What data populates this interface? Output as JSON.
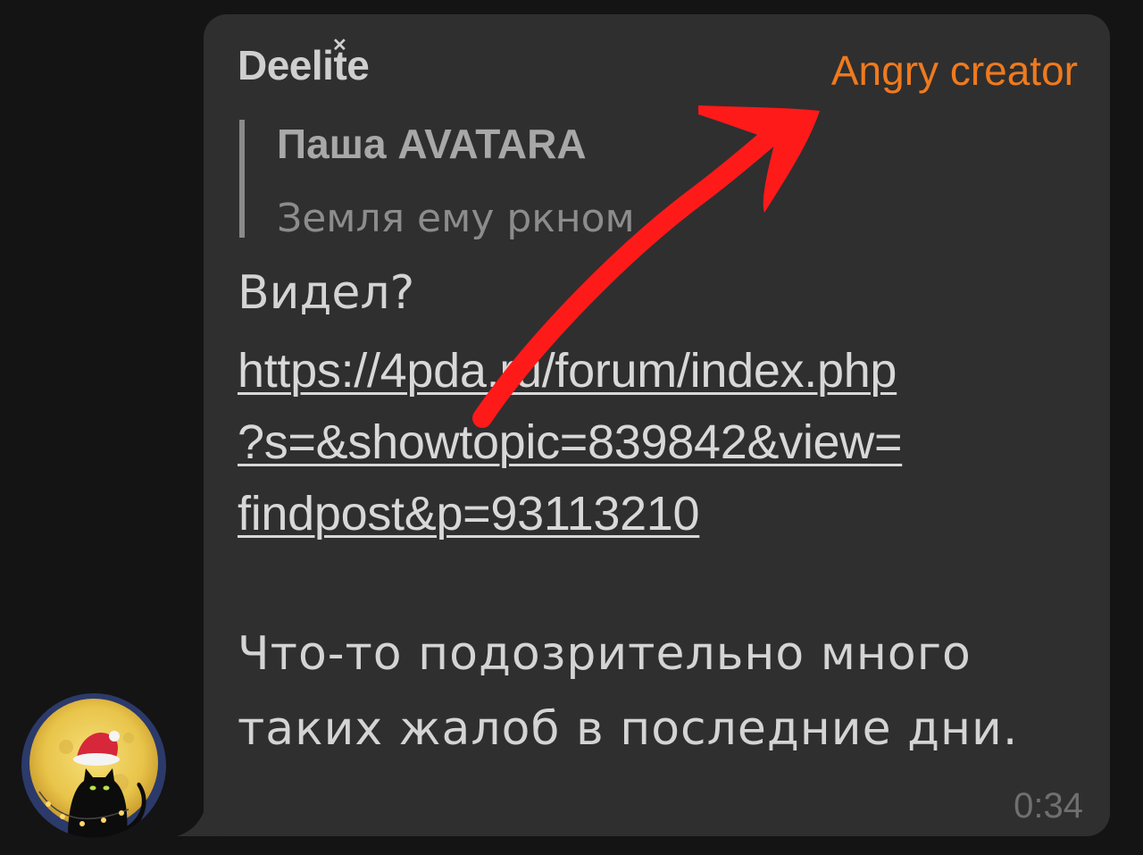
{
  "message": {
    "sender_name": "Deelite",
    "sender_role": "Angry creator",
    "reply": {
      "author": "Паша AVATARA",
      "text": "Земля ему ркном"
    },
    "text_line_1": "Видел?",
    "link": {
      "line_1": "https://4pda.ru/forum/index.php",
      "line_2": "?s=&showtopic=839842&view=",
      "line_3": "findpost&p=93113210"
    },
    "text_line_2": "Что-то подозрительно много",
    "text_line_3": "таких жалоб в последние дни.",
    "time": "0:34"
  },
  "colors": {
    "background": "#141414",
    "bubble": "#2f2f2f",
    "role_badge": "#ef7a1e",
    "annotation_arrow": "#ff1a1a"
  },
  "icons": {
    "avatar": "black-cat-santa-hat-moon-avatar",
    "annotation": "red-curved-arrow-annotation"
  }
}
